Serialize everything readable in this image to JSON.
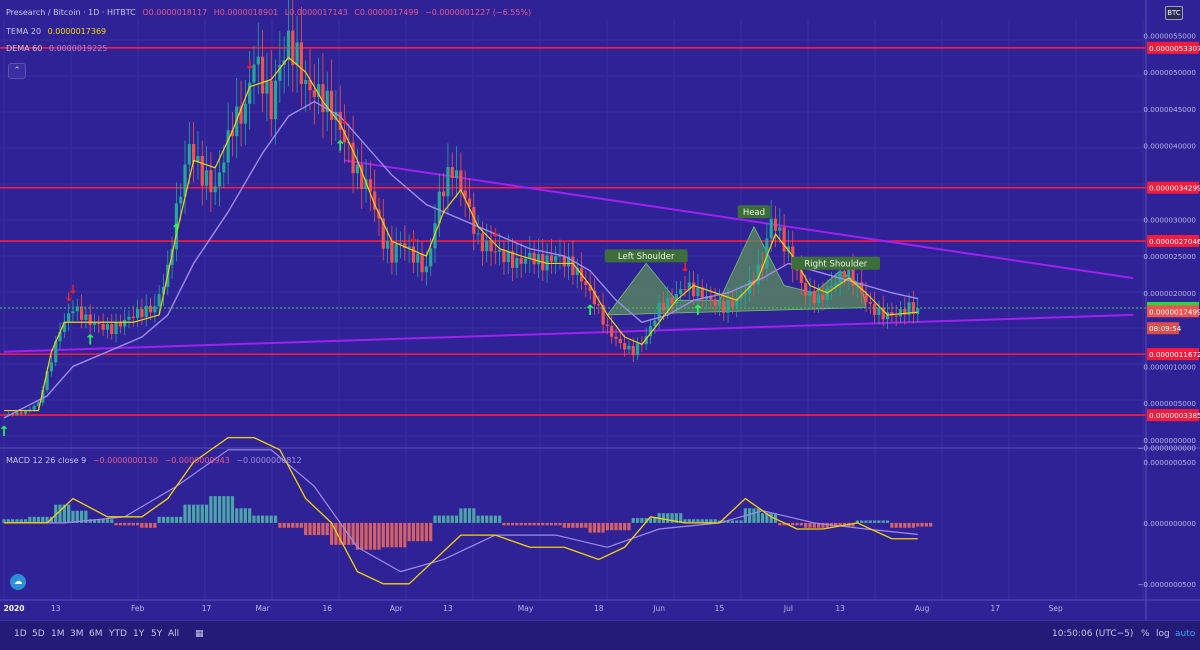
{
  "header": {
    "symbol": "Presearch / Bitcoin · 1D · HITBTC",
    "open": "O0.0000018117",
    "high": "H0.0000018901",
    "low": "L0.0000017143",
    "close": "C0.0000017499",
    "change": "−0.0000001227 (−6.55%)"
  },
  "indicators": {
    "tema_label": "TEMA 20",
    "tema_value": "0.0000017369",
    "dema_label": "DEMA 60",
    "dema_value": "0.0000019225",
    "macd_label": "MACD 12 26 close 9",
    "macd_value": "−0.0000000130",
    "macd_signal_value": "−0.0000000943",
    "macd_hist_value": "−0.0000000812"
  },
  "currency_badge": "BTC",
  "bottom_bar": {
    "ranges": [
      "1D",
      "5D",
      "1M",
      "3M",
      "6M",
      "YTD",
      "1Y",
      "5Y",
      "All"
    ],
    "time": "10:50:06 (UTC−5)",
    "percent": "%",
    "log": "log",
    "auto": "auto"
  },
  "colors": {
    "background": "#2f2296",
    "up_candle": "#26a69a",
    "down_candle": "#ef5350",
    "tema": "#f5d400",
    "dema": "#9f8de8",
    "resistance": "#ff1a3c",
    "trendline": "#a020f0",
    "price_line": "#3ccf4e",
    "buy_arrow": "#22ff55",
    "sell_arrow": "#ff2020"
  },
  "chart_data": {
    "type": "candlestick",
    "x_start": "2020-01-01",
    "x_ticks": [
      "2020",
      "13",
      "Feb",
      "17",
      "Mar",
      "16",
      "Apr",
      "13",
      "May",
      "18",
      "Jun",
      "15",
      "Jul",
      "13",
      "Aug",
      "17",
      "Sep"
    ],
    "y_ticks": [
      "0.0000055000",
      "0.0000050000",
      "0.0000045000",
      "0.0000040000",
      "0.0000030000",
      "0.0000025000",
      "0.0000020000",
      "0.0000010000",
      "0.0000005000",
      "0.0000000000",
      "−0.0000000000"
    ],
    "ylim": [
      0.0,
      5.6e-06
    ],
    "price_close_path": [
      [
        0,
        3.4e-07
      ],
      [
        5,
        3.8e-07
      ],
      [
        8,
        5e-07
      ],
      [
        11,
        1.1e-06
      ],
      [
        13,
        1.5e-06
      ],
      [
        16,
        1.8e-06
      ],
      [
        20,
        1.6e-06
      ],
      [
        25,
        1.5e-06
      ],
      [
        30,
        1.7e-06
      ],
      [
        35,
        1.8e-06
      ],
      [
        38,
        2.3e-06
      ],
      [
        40,
        3.1e-06
      ],
      [
        43,
        4e-06
      ],
      [
        46,
        3.6e-06
      ],
      [
        49,
        3.4e-06
      ],
      [
        53,
        4.3e-06
      ],
      [
        56,
        4.5e-06
      ],
      [
        58,
        5.2e-06
      ],
      [
        60,
        4.9e-06
      ],
      [
        62,
        4.5e-06
      ],
      [
        64,
        5.1e-06
      ],
      [
        66,
        5.4e-06
      ],
      [
        68,
        5.2e-06
      ],
      [
        70,
        4.8e-06
      ],
      [
        73,
        4.7e-06
      ],
      [
        76,
        4.5e-06
      ],
      [
        79,
        4.1e-06
      ],
      [
        82,
        3.6e-06
      ],
      [
        85,
        3.4e-06
      ],
      [
        88,
        2.7e-06
      ],
      [
        90,
        2.5e-06
      ],
      [
        92,
        2.7e-06
      ],
      [
        95,
        2.5e-06
      ],
      [
        98,
        2.3e-06
      ],
      [
        101,
        3.3e-06
      ],
      [
        104,
        3.7e-06
      ],
      [
        107,
        3.3e-06
      ],
      [
        110,
        2.7e-06
      ],
      [
        113,
        2.6e-06
      ],
      [
        116,
        2.5e-06
      ],
      [
        119,
        2.4e-06
      ],
      [
        122,
        2.5e-06
      ],
      [
        125,
        2.4e-06
      ],
      [
        128,
        2.5e-06
      ],
      [
        131,
        2.4e-06
      ],
      [
        134,
        2.2e-06
      ],
      [
        137,
        1.9e-06
      ],
      [
        140,
        1.5e-06
      ],
      [
        143,
        1.3e-06
      ],
      [
        146,
        1.2e-06
      ],
      [
        149,
        1.4e-06
      ],
      [
        152,
        1.8e-06
      ],
      [
        155,
        1.9e-06
      ],
      [
        158,
        2.1e-06
      ],
      [
        161,
        2e-06
      ],
      [
        164,
        1.9e-06
      ],
      [
        167,
        1.8e-06
      ],
      [
        170,
        1.9e-06
      ],
      [
        173,
        2.1e-06
      ],
      [
        176,
        2.4e-06
      ],
      [
        178,
        3e-06
      ],
      [
        180,
        2.8e-06
      ],
      [
        183,
        2.4e-06
      ],
      [
        186,
        2e-06
      ],
      [
        189,
        1.9e-06
      ],
      [
        192,
        2.1e-06
      ],
      [
        195,
        2.3e-06
      ],
      [
        198,
        2.1e-06
      ],
      [
        201,
        1.8e-06
      ],
      [
        204,
        1.7e-06
      ],
      [
        207,
        1.7e-06
      ],
      [
        210,
        1.8e-06
      ],
      [
        212,
        1.7499e-06
      ]
    ],
    "tema_path": [
      [
        0,
        4e-07
      ],
      [
        8,
        4e-07
      ],
      [
        11,
        1.2e-06
      ],
      [
        14,
        1.6e-06
      ],
      [
        20,
        1.6e-06
      ],
      [
        30,
        1.6e-06
      ],
      [
        36,
        1.7e-06
      ],
      [
        40,
        2.8e-06
      ],
      [
        44,
        3.8e-06
      ],
      [
        49,
        3.7e-06
      ],
      [
        53,
        4.2e-06
      ],
      [
        57,
        4.8e-06
      ],
      [
        62,
        4.9e-06
      ],
      [
        66,
        5.2e-06
      ],
      [
        70,
        5e-06
      ],
      [
        74,
        4.6e-06
      ],
      [
        78,
        4.3e-06
      ],
      [
        82,
        3.8e-06
      ],
      [
        86,
        3.2e-06
      ],
      [
        90,
        2.7e-06
      ],
      [
        94,
        2.6e-06
      ],
      [
        98,
        2.5e-06
      ],
      [
        102,
        3.1e-06
      ],
      [
        106,
        3.4e-06
      ],
      [
        110,
        2.9e-06
      ],
      [
        115,
        2.6e-06
      ],
      [
        120,
        2.5e-06
      ],
      [
        126,
        2.4e-06
      ],
      [
        132,
        2.4e-06
      ],
      [
        136,
        2.1e-06
      ],
      [
        140,
        1.7e-06
      ],
      [
        144,
        1.4e-06
      ],
      [
        148,
        1.3e-06
      ],
      [
        152,
        1.6e-06
      ],
      [
        156,
        1.9e-06
      ],
      [
        160,
        2.1e-06
      ],
      [
        165,
        2e-06
      ],
      [
        170,
        1.9e-06
      ],
      [
        175,
        2.2e-06
      ],
      [
        179,
        2.8e-06
      ],
      [
        183,
        2.5e-06
      ],
      [
        187,
        2.1e-06
      ],
      [
        191,
        2e-06
      ],
      [
        196,
        2.2e-06
      ],
      [
        200,
        2e-06
      ],
      [
        205,
        1.7e-06
      ],
      [
        212,
        1.7369e-06
      ]
    ],
    "dema_path": [
      [
        0,
        3e-07
      ],
      [
        10,
        6e-07
      ],
      [
        16,
        1e-06
      ],
      [
        24,
        1.2e-06
      ],
      [
        32,
        1.4e-06
      ],
      [
        38,
        1.7e-06
      ],
      [
        44,
        2.4e-06
      ],
      [
        52,
        3.1e-06
      ],
      [
        60,
        3.9e-06
      ],
      [
        66,
        4.4e-06
      ],
      [
        72,
        4.6e-06
      ],
      [
        78,
        4.4e-06
      ],
      [
        84,
        4e-06
      ],
      [
        90,
        3.6e-06
      ],
      [
        98,
        3.2e-06
      ],
      [
        106,
        3e-06
      ],
      [
        114,
        2.8e-06
      ],
      [
        122,
        2.6e-06
      ],
      [
        130,
        2.5e-06
      ],
      [
        136,
        2.3e-06
      ],
      [
        142,
        1.9e-06
      ],
      [
        148,
        1.6e-06
      ],
      [
        154,
        1.7e-06
      ],
      [
        160,
        1.9e-06
      ],
      [
        168,
        2e-06
      ],
      [
        176,
        2.2e-06
      ],
      [
        182,
        2.4e-06
      ],
      [
        188,
        2.3e-06
      ],
      [
        194,
        2.2e-06
      ],
      [
        200,
        2.1e-06
      ],
      [
        206,
        2e-06
      ],
      [
        212,
        1.9225e-06
      ]
    ],
    "horizontal_levels": [
      {
        "value": 5.3307e-06,
        "label": "0.0000053307"
      },
      {
        "value": 3.4299e-06,
        "label": "0.0000034299"
      },
      {
        "value": 2.7046e-06,
        "label": "0.0000027046"
      },
      {
        "value": 1.1672e-06,
        "label": "0.0000011672"
      },
      {
        "value": 3.385e-07,
        "label": "0.0000003385"
      }
    ],
    "price_labels": [
      {
        "value": 1.795e-06,
        "label": "0.0000017950",
        "kind": "green"
      },
      {
        "value": 1.7499e-06,
        "label": "0.0000017499",
        "kind": "red"
      },
      {
        "value": 1.52e-06,
        "label": "08:09:54",
        "kind": "red-small"
      }
    ],
    "trendlines": [
      {
        "from": [
          79,
          3.8e-06
        ],
        "to": [
          262,
          2.2e-06
        ]
      },
      {
        "from": [
          0,
          1.2e-06
        ],
        "to": [
          262,
          1.7e-06
        ]
      }
    ],
    "pattern_labels": [
      {
        "text": "Left Shoulder",
        "x": 149,
        "y": 2.4e-06
      },
      {
        "text": "Head",
        "x": 174,
        "y": 3e-06
      },
      {
        "text": "Right Shoulder",
        "x": 193,
        "y": 2.3e-06
      }
    ],
    "buy_arrows_days": [
      0,
      20,
      40,
      78,
      136,
      161
    ],
    "sell_arrows_days": [
      15,
      16,
      57,
      79,
      95,
      114,
      158
    ],
    "macd": {
      "ylim": [
        -6e-08,
        5e-08
      ],
      "y_ticks": [
        "0.0000000500",
        "0.0000000000",
        "−0.0000000500"
      ],
      "macd_path": [
        [
          0,
          0.0
        ],
        [
          10,
          0.0
        ],
        [
          16,
          2e-08
        ],
        [
          24,
          5e-09
        ],
        [
          32,
          5e-09
        ],
        [
          38,
          2e-08
        ],
        [
          44,
          5e-08
        ],
        [
          52,
          7e-08
        ],
        [
          58,
          7e-08
        ],
        [
          64,
          6e-08
        ],
        [
          70,
          2e-08
        ],
        [
          76,
          0.0
        ],
        [
          82,
          -4e-08
        ],
        [
          88,
          -5e-08
        ],
        [
          94,
          -5e-08
        ],
        [
          100,
          -3e-08
        ],
        [
          106,
          -1e-08
        ],
        [
          114,
          -1e-08
        ],
        [
          122,
          -2e-08
        ],
        [
          130,
          -2e-08
        ],
        [
          138,
          -3e-08
        ],
        [
          144,
          -2e-08
        ],
        [
          150,
          5e-09
        ],
        [
          158,
          0.0
        ],
        [
          166,
          0.0
        ],
        [
          172,
          2e-08
        ],
        [
          178,
          5e-09
        ],
        [
          184,
          -5e-09
        ],
        [
          190,
          -5e-09
        ],
        [
          198,
          0.0
        ],
        [
          206,
          -1.3e-08
        ],
        [
          212,
          -1.3e-08
        ]
      ],
      "signal_path": [
        [
          0,
          0.0
        ],
        [
          14,
          0.0
        ],
        [
          28,
          5e-09
        ],
        [
          40,
          3e-08
        ],
        [
          52,
          6e-08
        ],
        [
          62,
          6e-08
        ],
        [
          72,
          3e-08
        ],
        [
          82,
          -2e-08
        ],
        [
          92,
          -4e-08
        ],
        [
          102,
          -3e-08
        ],
        [
          114,
          -1e-08
        ],
        [
          128,
          -1e-08
        ],
        [
          140,
          -2e-08
        ],
        [
          152,
          -5e-09
        ],
        [
          166,
          0.0
        ],
        [
          176,
          1e-08
        ],
        [
          188,
          0.0
        ],
        [
          200,
          -5e-09
        ],
        [
          212,
          -9.4e-09
        ]
      ],
      "hist": [
        [
          0,
          3e-09
        ],
        [
          6,
          5e-09
        ],
        [
          12,
          1.5e-08
        ],
        [
          16,
          1e-08
        ],
        [
          20,
          3e-09
        ],
        [
          26,
          -2e-09
        ],
        [
          32,
          -4e-09
        ],
        [
          36,
          5e-09
        ],
        [
          42,
          1.5e-08
        ],
        [
          48,
          2.2e-08
        ],
        [
          54,
          1.2e-08
        ],
        [
          58,
          6e-09
        ],
        [
          64,
          -4e-09
        ],
        [
          70,
          -1e-08
        ],
        [
          76,
          -1.8e-08
        ],
        [
          82,
          -2.2e-08
        ],
        [
          88,
          -2e-08
        ],
        [
          94,
          -1.5e-08
        ],
        [
          100,
          6e-09
        ],
        [
          106,
          1.2e-08
        ],
        [
          110,
          6e-09
        ],
        [
          116,
          -2e-09
        ],
        [
          124,
          -2e-09
        ],
        [
          130,
          -4e-09
        ],
        [
          136,
          -8e-09
        ],
        [
          140,
          -6e-09
        ],
        [
          146,
          4e-09
        ],
        [
          152,
          8e-09
        ],
        [
          158,
          3e-09
        ],
        [
          166,
          2e-09
        ],
        [
          172,
          1.2e-08
        ],
        [
          176,
          8e-09
        ],
        [
          180,
          -2e-09
        ],
        [
          186,
          -4e-09
        ],
        [
          192,
          -3e-09
        ],
        [
          198,
          2e-09
        ],
        [
          206,
          -4e-09
        ],
        [
          212,
          -3e-09
        ]
      ]
    }
  }
}
